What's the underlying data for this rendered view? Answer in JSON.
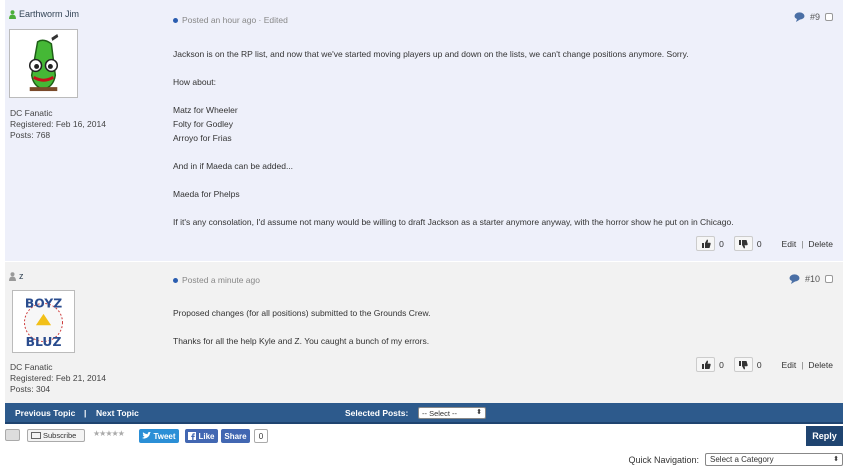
{
  "posts": [
    {
      "username": "Earthworm Jim",
      "rank": "DC Fanatic",
      "registered": "Registered: Feb 16, 2014",
      "posts_count": "Posts: 768",
      "posted": "Posted an hour ago · Edited",
      "number": "#9",
      "body": "Jackson is on the RP list, and now that we've started moving players up and down on the lists, we can't change positions anymore. Sorry.\n\nHow about:\n\nMatz for Wheeler\nFolty for Godley\nArroyo for Frias\n\nAnd in if Maeda can be added...\n\nMaeda for Phelps\n\nIf it's any consolation, I'd assume not many would be willing to draft Jackson as a starter anymore anyway, with the horror show he put on in Chicago.",
      "likes": "0",
      "dislikes": "0",
      "edit_label": "Edit",
      "delete_label": "Delete"
    },
    {
      "username": "z",
      "avatar_text_top": "BOYZ",
      "avatar_text_bottom": "BLUZ",
      "rank": "DC Fanatic",
      "registered": "Registered: Feb 21, 2014",
      "posts_count": "Posts: 304",
      "posted": "Posted a minute ago",
      "number": "#10",
      "body": "Proposed changes (for all positions) submitted to the Grounds Crew.\n\nThanks for all the help Kyle and Z. You caught a bunch of my errors.",
      "likes": "0",
      "dislikes": "0",
      "edit_label": "Edit",
      "delete_label": "Delete"
    }
  ],
  "navbar": {
    "previous_topic": "Previous Topic",
    "separator": "|",
    "next_topic": "Next Topic",
    "selected_posts": "Selected Posts:",
    "select_value": "-- Select --"
  },
  "sharebar": {
    "subscribe": "Subscribe",
    "rating_stars": "★★★★★",
    "tweet": "Tweet",
    "like": "Like",
    "share": "Share",
    "share_count": "0",
    "reply": "Reply"
  },
  "quick_navigation": {
    "label": "Quick Navigation:",
    "select_value": "Select a Category"
  },
  "colors": {
    "navbar": "#2d5a8c",
    "post_dot": "#2a5db0",
    "twitter": "#2b8fd6",
    "facebook": "#4267b2",
    "online_user": "#4caf3a",
    "offline_user": "#999999"
  }
}
